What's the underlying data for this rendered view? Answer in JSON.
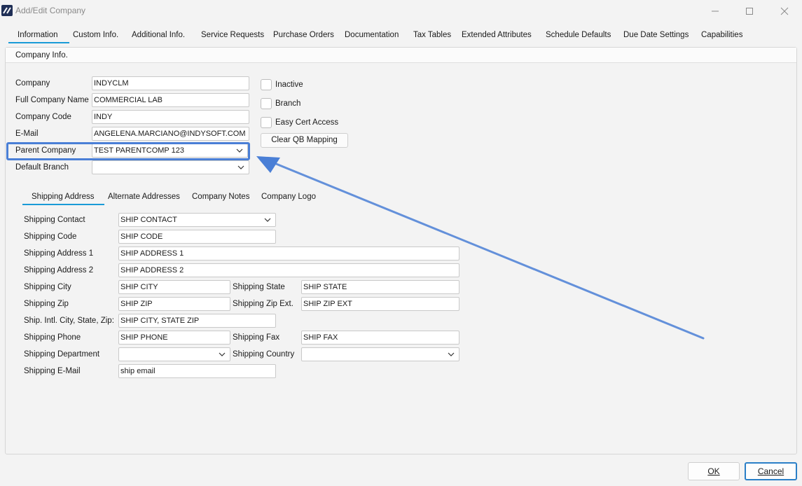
{
  "window": {
    "title": "Add/Edit Company"
  },
  "tabs": [
    "Information",
    "Custom Info.",
    "Additional Info.",
    "Service Requests",
    "Purchase Orders",
    "Documentation",
    "Tax Tables",
    "Extended Attributes",
    "Schedule Defaults",
    "Due Date Settings",
    "Capabilities"
  ],
  "section": {
    "title": "Company Info."
  },
  "company": {
    "company_label": "Company",
    "company_value": "INDYCLM",
    "full_name_label": "Full Company Name",
    "full_name_value": "COMMERCIAL LAB",
    "code_label": "Company Code",
    "code_value": "INDY",
    "email_label": "E-Mail",
    "email_value": "ANGELENA.MARCIANO@INDYSOFT.COM",
    "parent_label": "Parent Company",
    "parent_value": "TEST PARENTCOMP 123",
    "branch_label": "Default Branch",
    "branch_value": ""
  },
  "checks": {
    "inactive": "Inactive",
    "branch": "Branch",
    "easy_cert": "Easy Cert Access",
    "clear_qb": "Clear QB Mapping"
  },
  "subtabs": [
    "Shipping Address",
    "Alternate Addresses",
    "Company Notes",
    "Company Logo"
  ],
  "shipping": {
    "contact_label": "Shipping Contact",
    "contact_value": "SHIP CONTACT",
    "code_label": "Shipping Code",
    "code_value": "SHIP CODE",
    "addr1_label": "Shipping Address 1",
    "addr1_value": "SHIP ADDRESS 1",
    "addr2_label": "Shipping Address 2",
    "addr2_value": "SHIP ADDRESS 2",
    "city_label": "Shipping City",
    "city_value": "SHIP CITY",
    "state_label": "Shipping State",
    "state_value": "SHIP STATE",
    "zip_label": "Shipping Zip",
    "zip_value": "SHIP ZIP",
    "zipext_label": "Shipping Zip Ext.",
    "zipext_value": "SHIP ZIP EXT",
    "intl_label": "Ship. Intl. City, State, Zip:",
    "intl_value": "SHIP CITY, STATE ZIP",
    "phone_label": "Shipping Phone",
    "phone_value": "SHIP PHONE",
    "fax_label": "Shipping Fax",
    "fax_value": "SHIP FAX",
    "dept_label": "Shipping Department",
    "dept_value": "",
    "country_label": "Shipping Country",
    "country_value": "",
    "email_label": "Shipping E-Mail",
    "email_value": "ship email"
  },
  "buttons": {
    "ok": "OK",
    "cancel": "Cancel"
  },
  "colors": {
    "accent": "#1a9bd7",
    "highlight": "#4a7fd6"
  }
}
